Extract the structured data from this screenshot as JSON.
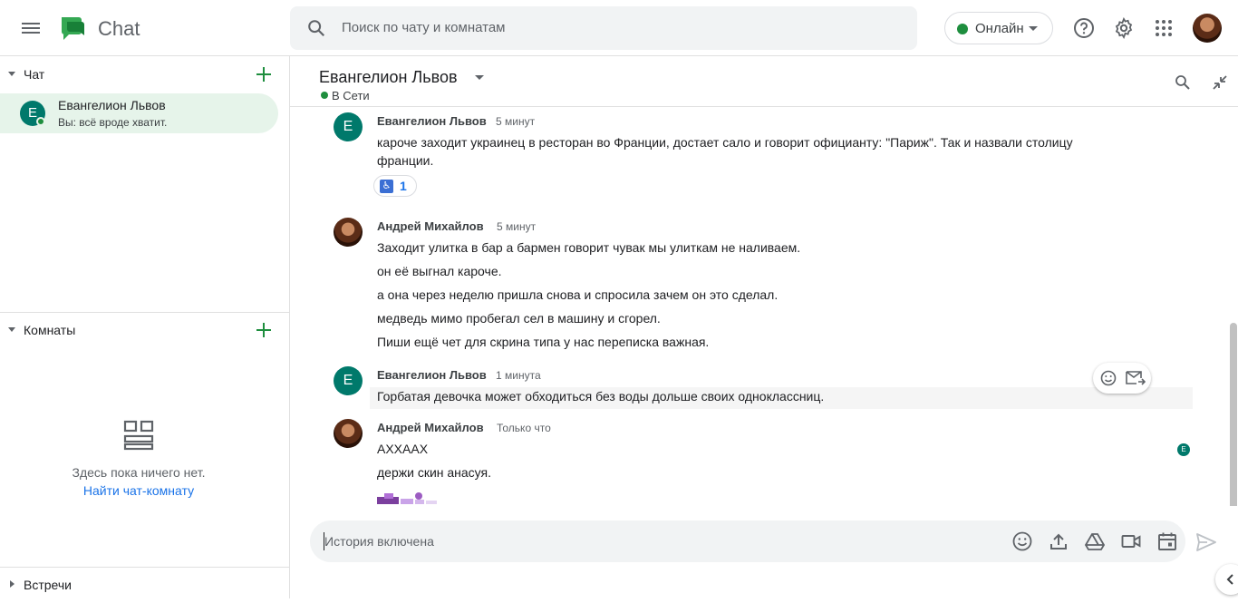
{
  "app": {
    "name": "Chat"
  },
  "search": {
    "placeholder": "Поиск по чату и комнатам"
  },
  "status": {
    "label": "Онлайн",
    "color": "#1e8e3e"
  },
  "icons": {
    "help": "help-icon",
    "settings": "gear-icon",
    "apps": "apps-grid-icon"
  },
  "sidebar": {
    "chat_section": "Чат",
    "rooms_section": "Комнаты",
    "meetings_section": "Встречи",
    "chats": [
      {
        "initial": "E",
        "name": "Евангелион Львов",
        "preview": "Вы: всё вроде хватит."
      }
    ],
    "rooms_empty": {
      "text": "Здесь пока ничего нет.",
      "link": "Найти чат-комнату"
    }
  },
  "conversation": {
    "title": "Евангелион Львов",
    "status": "В Сети",
    "messages": [
      {
        "sender": "Евангелион Львов",
        "initial": "E",
        "time": "5 минут",
        "lines": [
          "кароче заходит украинец в ресторан во Франции, достает сало и говорит официанту: \"Париж\". Так и назвали столицу",
          "франции."
        ],
        "reaction": {
          "emoji": "♿",
          "count": "1"
        }
      },
      {
        "sender": "Андрей Михайлов",
        "time": "5 минут",
        "lines": [
          "Заходит улитка в бар а бармен говорит чувак мы улиткам не наливаем.",
          "он её выгнал кароче.",
          "а она через неделю пришла снова и спросила зачем он это сделал.",
          "медведь мимо пробегал сел в машину и сгорел.",
          "Пиши ещё чет для скрина типа у нас переписка важная."
        ]
      },
      {
        "sender": "Евангелион Львов",
        "initial": "E",
        "time": "1 минута",
        "lines": [
          "Горбатая девочка может обходиться без воды дольше своих одноклассниц."
        ]
      },
      {
        "sender": "Андрей Михайлов",
        "time": "Только что",
        "lines": [
          "АХХААХ",
          "держи скин анасуя."
        ],
        "read_initial": "E"
      }
    ]
  },
  "composer": {
    "placeholder": "История включена"
  },
  "colors": {
    "accent": "#1e8e3e",
    "selected": "#e6f4ea",
    "avatar": "#00796b",
    "link": "#1a73e8"
  }
}
